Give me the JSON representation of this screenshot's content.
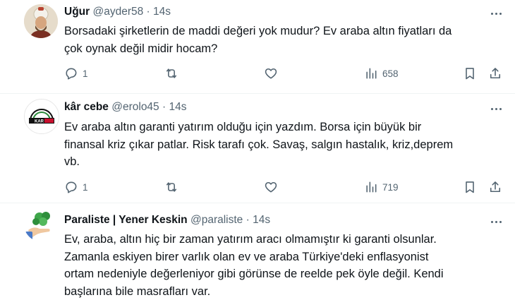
{
  "tweets": [
    {
      "name": "Uğur",
      "handle": "@ayder58",
      "separator": "·",
      "time": "14s",
      "line1": "Borsadaki şirketlerin de maddi değeri yok mudur? Ev araba altın fiyatları da",
      "line2": "çok oynak değil midir hocam?",
      "replies": "1",
      "views": "658"
    },
    {
      "name": "kâr cebe",
      "handle": "@erolo45",
      "separator": "·",
      "time": "14s",
      "line1": "Ev araba altın garanti yatırım olduğu için yazdım. Borsa için büyük bir",
      "line2": "finansal kriz çıkar patlar. Risk tarafı çok. Savaş, salgın hastalık, kriz,deprem",
      "line3": "vb.",
      "replies": "1",
      "views": "719",
      "avatar_text": "KAR"
    },
    {
      "name": "Paraliste | Yener Keskin",
      "handle": "@paraliste",
      "separator": "·",
      "time": "14s",
      "line1": "Ev, araba, altın hiç bir zaman yatırım aracı olmamıştır ki garanti olsunlar.",
      "line2": "Zamanla eskiyen birer varlık olan ev ve araba Türkiye'deki enflasyonist",
      "line3": "ortam nedeniyle değerleniyor gibi görünse de reelde pek öyle değil. Kendi",
      "line4": "başlarına bile masrafları var."
    }
  ],
  "icons": [
    "reply-icon",
    "retweet-icon",
    "like-icon",
    "views-icon",
    "bookmark-icon",
    "share-icon",
    "more-icon"
  ],
  "colors": {
    "text": "#0f1419",
    "secondary": "#536471",
    "divider": "#eff3f4",
    "background": "#ffffff"
  }
}
